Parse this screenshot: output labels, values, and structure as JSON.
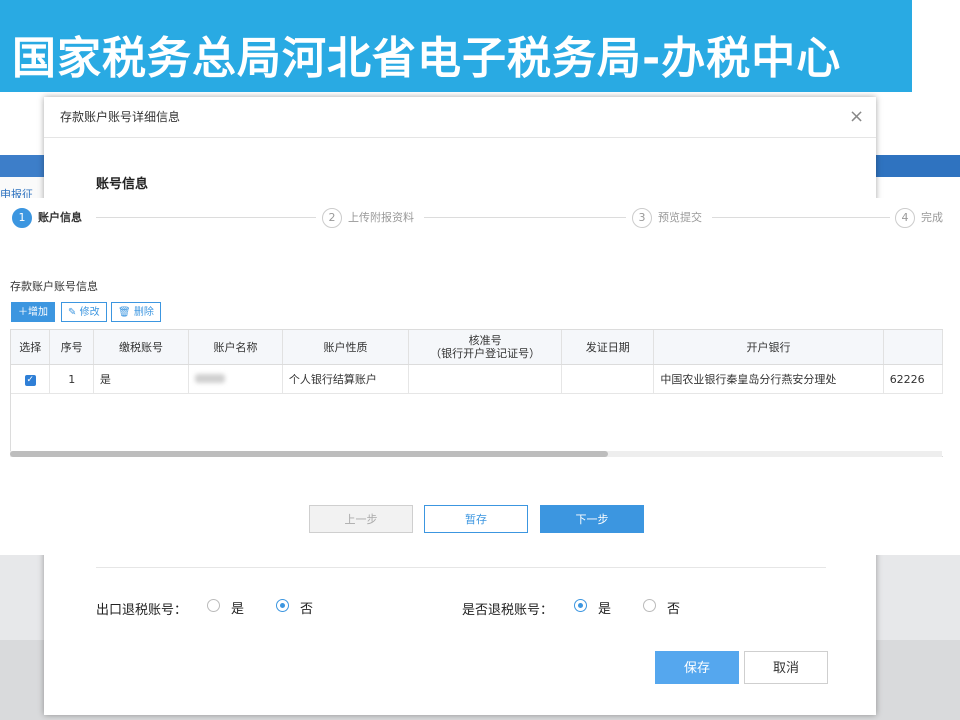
{
  "banner": {
    "title": "国家税务总局河北省电子税务局-办税中心"
  },
  "background_page": {
    "breadcrumb": "申报征"
  },
  "modal": {
    "title": "存款账户账号详细信息",
    "close": "×",
    "section_title": "账号信息"
  },
  "steps": [
    {
      "num": "1",
      "label": "账户信息"
    },
    {
      "num": "2",
      "label": "上传附报资料"
    },
    {
      "num": "3",
      "label": "预览提交"
    },
    {
      "num": "4",
      "label": "完成"
    }
  ],
  "table": {
    "caption": "存款账户账号信息",
    "toolbar": {
      "add": "增加",
      "edit": "修改",
      "delete": "删除"
    },
    "columns": [
      "选择",
      "序号",
      "缴税账号",
      "账户名称",
      "账户性质",
      "核准号",
      "（银行开户登记证号）",
      "发证日期",
      "开户银行"
    ],
    "rows": [
      {
        "select": "✓",
        "seq": "1",
        "tax_account": "是",
        "account_name": "",
        "account_type": "个人银行结算账户",
        "approval_no": "",
        "issue_date": "",
        "bank": "中国农业银行秦皇岛分行燕安分理处",
        "account_no": "62226"
      }
    ]
  },
  "nav": {
    "prev": "上一步",
    "save": "暂存",
    "next": "下一步"
  },
  "form": {
    "export_refund_label": "出口退税账号：",
    "refund_label": "是否退税账号：",
    "yes": "是",
    "no": "否",
    "export_refund_value": "否",
    "refund_value": "是"
  },
  "footer": {
    "save": "保存",
    "cancel": "取消"
  },
  "colors": {
    "accent": "#3c96e0",
    "banner": "#29aae3"
  }
}
